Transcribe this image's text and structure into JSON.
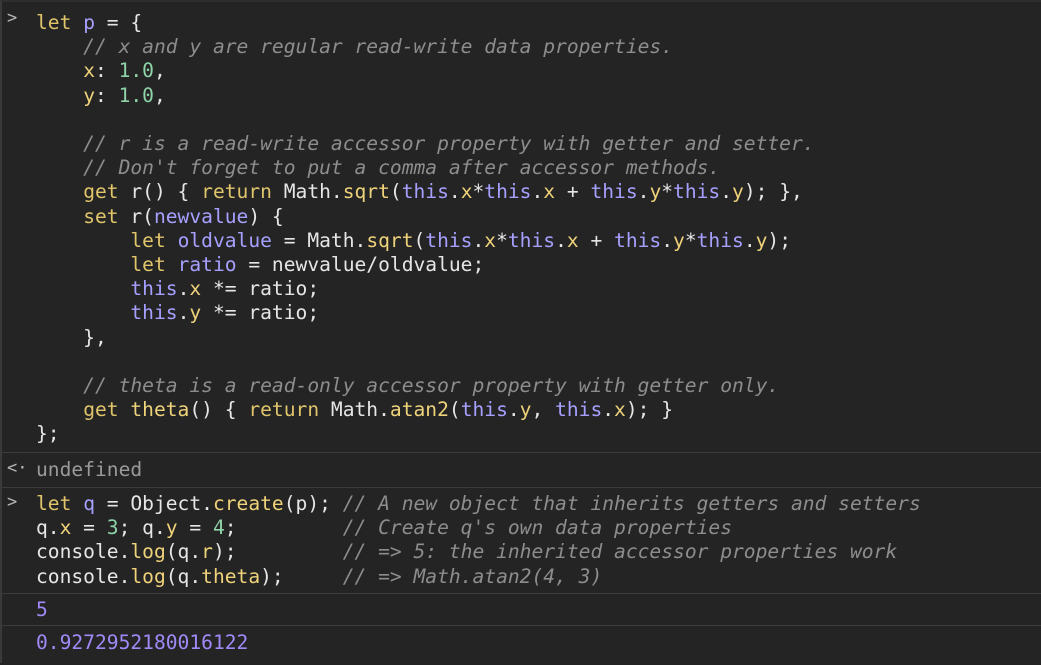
{
  "console": {
    "entries": [
      {
        "kind": "input",
        "prompt": ">",
        "lines": [
          [
            {
              "t": "let",
              "c": "kw"
            },
            {
              "t": " ",
              "c": "pl"
            },
            {
              "t": "p",
              "c": "var"
            },
            {
              "t": " = {",
              "c": "pl"
            }
          ],
          [
            {
              "t": "    // x and y are regular read-write data properties.",
              "c": "cm"
            }
          ],
          [
            {
              "t": "    ",
              "c": "pl"
            },
            {
              "t": "x",
              "c": "prop"
            },
            {
              "t": ": ",
              "c": "pl"
            },
            {
              "t": "1.0",
              "c": "num"
            },
            {
              "t": ",",
              "c": "pl"
            }
          ],
          [
            {
              "t": "    ",
              "c": "pl"
            },
            {
              "t": "y",
              "c": "prop"
            },
            {
              "t": ": ",
              "c": "pl"
            },
            {
              "t": "1.0",
              "c": "num"
            },
            {
              "t": ",",
              "c": "pl"
            }
          ],
          [
            {
              "t": "",
              "c": "pl"
            }
          ],
          [
            {
              "t": "    // r is a read-write accessor property with getter and setter.",
              "c": "cm"
            }
          ],
          [
            {
              "t": "    // Don't forget to put a comma after accessor methods.",
              "c": "cm"
            }
          ],
          [
            {
              "t": "    ",
              "c": "pl"
            },
            {
              "t": "get",
              "c": "kw"
            },
            {
              "t": " r() { ",
              "c": "pl"
            },
            {
              "t": "return",
              "c": "kw"
            },
            {
              "t": " Math.",
              "c": "pl"
            },
            {
              "t": "sqrt",
              "c": "fn"
            },
            {
              "t": "(",
              "c": "pl"
            },
            {
              "t": "this",
              "c": "var"
            },
            {
              "t": ".",
              "c": "pl"
            },
            {
              "t": "x",
              "c": "prop"
            },
            {
              "t": "*",
              "c": "pl"
            },
            {
              "t": "this",
              "c": "var"
            },
            {
              "t": ".",
              "c": "pl"
            },
            {
              "t": "x",
              "c": "prop"
            },
            {
              "t": " + ",
              "c": "pl"
            },
            {
              "t": "this",
              "c": "var"
            },
            {
              "t": ".",
              "c": "pl"
            },
            {
              "t": "y",
              "c": "prop"
            },
            {
              "t": "*",
              "c": "pl"
            },
            {
              "t": "this",
              "c": "var"
            },
            {
              "t": ".",
              "c": "pl"
            },
            {
              "t": "y",
              "c": "prop"
            },
            {
              "t": "); },",
              "c": "pl"
            }
          ],
          [
            {
              "t": "    ",
              "c": "pl"
            },
            {
              "t": "set",
              "c": "kw"
            },
            {
              "t": " r(",
              "c": "pl"
            },
            {
              "t": "newvalue",
              "c": "var"
            },
            {
              "t": ") {",
              "c": "pl"
            }
          ],
          [
            {
              "t": "        ",
              "c": "pl"
            },
            {
              "t": "let",
              "c": "kw"
            },
            {
              "t": " ",
              "c": "pl"
            },
            {
              "t": "oldvalue",
              "c": "var"
            },
            {
              "t": " = Math.",
              "c": "pl"
            },
            {
              "t": "sqrt",
              "c": "fn"
            },
            {
              "t": "(",
              "c": "pl"
            },
            {
              "t": "this",
              "c": "var"
            },
            {
              "t": ".",
              "c": "pl"
            },
            {
              "t": "x",
              "c": "prop"
            },
            {
              "t": "*",
              "c": "pl"
            },
            {
              "t": "this",
              "c": "var"
            },
            {
              "t": ".",
              "c": "pl"
            },
            {
              "t": "x",
              "c": "prop"
            },
            {
              "t": " + ",
              "c": "pl"
            },
            {
              "t": "this",
              "c": "var"
            },
            {
              "t": ".",
              "c": "pl"
            },
            {
              "t": "y",
              "c": "prop"
            },
            {
              "t": "*",
              "c": "pl"
            },
            {
              "t": "this",
              "c": "var"
            },
            {
              "t": ".",
              "c": "pl"
            },
            {
              "t": "y",
              "c": "prop"
            },
            {
              "t": ");",
              "c": "pl"
            }
          ],
          [
            {
              "t": "        ",
              "c": "pl"
            },
            {
              "t": "let",
              "c": "kw"
            },
            {
              "t": " ",
              "c": "pl"
            },
            {
              "t": "ratio",
              "c": "var"
            },
            {
              "t": " = newvalue/oldvalue;",
              "c": "pl"
            }
          ],
          [
            {
              "t": "        ",
              "c": "pl"
            },
            {
              "t": "this",
              "c": "var"
            },
            {
              "t": ".",
              "c": "pl"
            },
            {
              "t": "x",
              "c": "prop"
            },
            {
              "t": " *= ratio;",
              "c": "pl"
            }
          ],
          [
            {
              "t": "        ",
              "c": "pl"
            },
            {
              "t": "this",
              "c": "var"
            },
            {
              "t": ".",
              "c": "pl"
            },
            {
              "t": "y",
              "c": "prop"
            },
            {
              "t": " *= ratio;",
              "c": "pl"
            }
          ],
          [
            {
              "t": "    },",
              "c": "pl"
            }
          ],
          [
            {
              "t": "",
              "c": "pl"
            }
          ],
          [
            {
              "t": "    // theta is a read-only accessor property with getter only.",
              "c": "cm"
            }
          ],
          [
            {
              "t": "    ",
              "c": "pl"
            },
            {
              "t": "get",
              "c": "kw"
            },
            {
              "t": " ",
              "c": "pl"
            },
            {
              "t": "theta",
              "c": "fn"
            },
            {
              "t": "() { ",
              "c": "pl"
            },
            {
              "t": "return",
              "c": "kw"
            },
            {
              "t": " Math.",
              "c": "pl"
            },
            {
              "t": "atan2",
              "c": "fn"
            },
            {
              "t": "(",
              "c": "pl"
            },
            {
              "t": "this",
              "c": "var"
            },
            {
              "t": ".",
              "c": "pl"
            },
            {
              "t": "y",
              "c": "prop"
            },
            {
              "t": ", ",
              "c": "pl"
            },
            {
              "t": "this",
              "c": "var"
            },
            {
              "t": ".",
              "c": "pl"
            },
            {
              "t": "x",
              "c": "prop"
            },
            {
              "t": "); }",
              "c": "pl"
            }
          ],
          [
            {
              "t": "};",
              "c": "pl"
            }
          ]
        ]
      },
      {
        "kind": "result",
        "prompt": "<·",
        "lines": [
          [
            {
              "t": "undefined",
              "c": "undef"
            }
          ]
        ]
      },
      {
        "kind": "input",
        "prompt": ">",
        "lines": [
          [
            {
              "t": "let",
              "c": "kw"
            },
            {
              "t": " ",
              "c": "pl"
            },
            {
              "t": "q",
              "c": "var"
            },
            {
              "t": " = Object.",
              "c": "pl"
            },
            {
              "t": "create",
              "c": "fn"
            },
            {
              "t": "(p); ",
              "c": "pl"
            },
            {
              "t": "// A new object that inherits getters and setters",
              "c": "cm"
            }
          ],
          [
            {
              "t": "q.",
              "c": "pl"
            },
            {
              "t": "x",
              "c": "prop"
            },
            {
              "t": " = ",
              "c": "pl"
            },
            {
              "t": "3",
              "c": "num"
            },
            {
              "t": "; q.",
              "c": "pl"
            },
            {
              "t": "y",
              "c": "prop"
            },
            {
              "t": " = ",
              "c": "pl"
            },
            {
              "t": "4",
              "c": "num"
            },
            {
              "t": ";         ",
              "c": "pl"
            },
            {
              "t": "// Create q's own data properties",
              "c": "cm"
            }
          ],
          [
            {
              "t": "console.",
              "c": "pl"
            },
            {
              "t": "log",
              "c": "fn"
            },
            {
              "t": "(q.",
              "c": "pl"
            },
            {
              "t": "r",
              "c": "prop"
            },
            {
              "t": ");         ",
              "c": "pl"
            },
            {
              "t": "// => 5: the inherited accessor properties work",
              "c": "cm"
            }
          ],
          [
            {
              "t": "console.",
              "c": "pl"
            },
            {
              "t": "log",
              "c": "fn"
            },
            {
              "t": "(q.",
              "c": "pl"
            },
            {
              "t": "theta",
              "c": "prop"
            },
            {
              "t": ");     ",
              "c": "pl"
            },
            {
              "t": "// => Math.atan2(4, 3)",
              "c": "cm"
            }
          ]
        ]
      },
      {
        "kind": "output",
        "prompt": "",
        "lines": [
          [
            {
              "t": "5",
              "c": "num-out"
            }
          ]
        ]
      },
      {
        "kind": "output",
        "prompt": "",
        "lines": [
          [
            {
              "t": "0.9272952180016122",
              "c": "num-out"
            }
          ]
        ]
      }
    ]
  },
  "colors": {
    "background": "#242424",
    "keyword": "#e0c56b",
    "variable": "#a6a0ff",
    "comment": "#8d8d8d",
    "number": "#8fd3a8",
    "output_number": "#a18af7"
  }
}
